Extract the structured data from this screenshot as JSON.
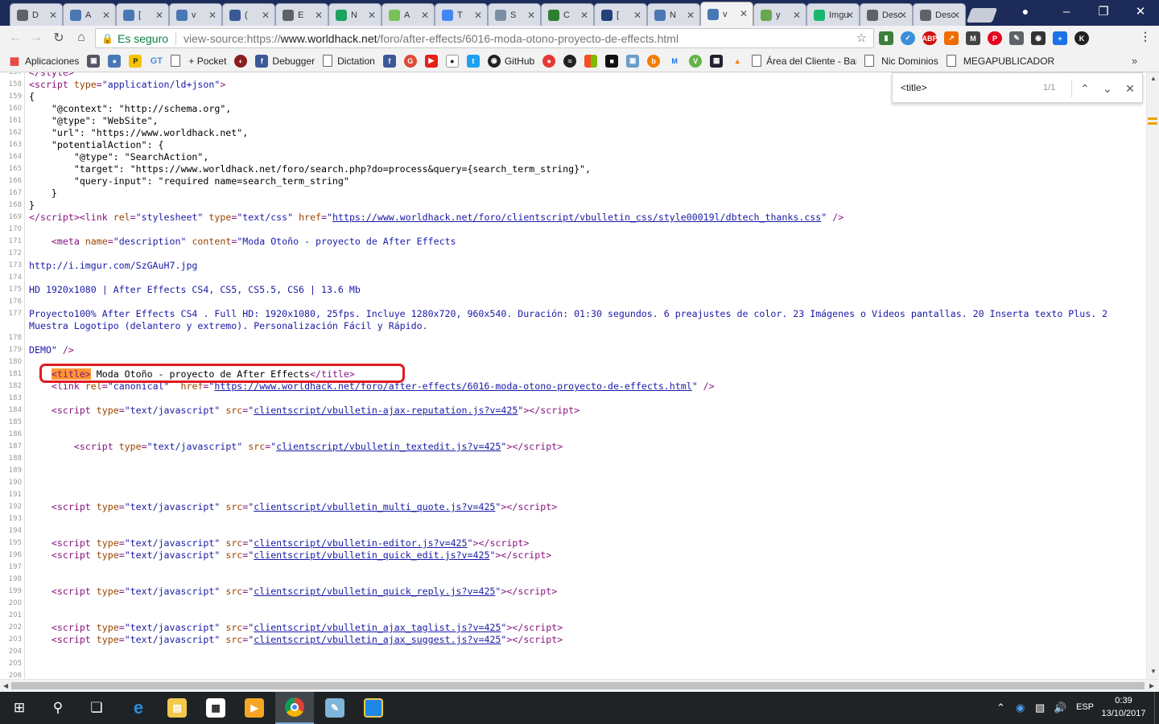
{
  "browser": {
    "tabs": [
      {
        "title": "D",
        "icon": "document-icon",
        "color": "#5f6368"
      },
      {
        "title": "A",
        "icon": "worldhack-icon",
        "color": "#4a78b5"
      },
      {
        "title": "[",
        "icon": "worldhack-icon",
        "color": "#4a78b5"
      },
      {
        "title": "v",
        "icon": "worldhack-icon",
        "color": "#4a78b5"
      },
      {
        "title": "(",
        "icon": "facebook-icon",
        "color": "#3b5998"
      },
      {
        "title": "E",
        "icon": "document-icon",
        "color": "#5f6368"
      },
      {
        "title": "N",
        "icon": "play-icon",
        "color": "#1aa260"
      },
      {
        "title": "A",
        "icon": "android-icon",
        "color": "#78c257"
      },
      {
        "title": "T",
        "icon": "translate-icon",
        "color": "#4285f4"
      },
      {
        "title": "S",
        "icon": "save-icon",
        "color": "#7a8fa6"
      },
      {
        "title": "C",
        "icon": "game-icon",
        "color": "#2e7d32"
      },
      {
        "title": "[",
        "icon": "mastodon-icon",
        "color": "#24427a"
      },
      {
        "title": "N",
        "icon": "worldhack-icon",
        "color": "#4a78b5"
      },
      {
        "title": "v",
        "icon": "worldhack-icon",
        "color": "#4a78b5",
        "active": true
      },
      {
        "title": "y",
        "icon": "circle-green-icon",
        "color": "#6aa84f"
      },
      {
        "title": "Imgu",
        "icon": "imgur-icon",
        "color": "#1bb76e"
      },
      {
        "title": "Desc",
        "icon": "download-icon",
        "color": "#5f6368"
      },
      {
        "title": "Desc",
        "icon": "document-icon",
        "color": "#5f6368"
      }
    ],
    "omnibox": {
      "secure_label": "Es seguro",
      "url_prefix": "view-source:",
      "url_scheme": "https://",
      "url_host": "www.worldhack.net",
      "url_path": "/foro/after-effects/6016-moda-otono-proyecto-de-effects.html"
    }
  },
  "bookmarks": {
    "apps_label": "Aplicaciones",
    "pocket_label": "+ Pocket",
    "debugger_label": "Debugger",
    "dictation_label": "Dictation",
    "github_label": "GitHub",
    "area_cliente_label": "Área del Cliente - Bar",
    "nic_label": "Nic Dominios",
    "megapub_label": "MEGAPUBLICADOR",
    "gt_label": "GT"
  },
  "find": {
    "query": "<title>",
    "count": "1/1"
  },
  "source": {
    "lines": [
      {
        "n": "157",
        "html": "<span class='tag'>&lt;/style&gt;</span>"
      },
      {
        "n": "158",
        "html": "<span class='tag'>&lt;script</span> <span class='attr'>type</span><span class='tag'>=</span><span class='val'>\"application/ld+json\"</span><span class='tag'>&gt;</span>"
      },
      {
        "n": "159",
        "html": "{"
      },
      {
        "n": "160",
        "html": "    \"@context\": \"http://schema.org\","
      },
      {
        "n": "161",
        "html": "    \"@type\": \"WebSite\","
      },
      {
        "n": "162",
        "html": "    \"url\": \"https://www.worldhack.net\","
      },
      {
        "n": "163",
        "html": "    \"potentialAction\": {"
      },
      {
        "n": "164",
        "html": "        \"@type\": \"SearchAction\","
      },
      {
        "n": "165",
        "html": "        \"target\": \"https://www.worldhack.net/foro/search.php?do=process&amp;query={search_term_string}\","
      },
      {
        "n": "166",
        "html": "        \"query-input\": \"required name=search_term_string\""
      },
      {
        "n": "167",
        "html": "    }"
      },
      {
        "n": "168",
        "html": "}"
      },
      {
        "n": "169",
        "html": "<span class='tag'>&lt;/script&gt;&lt;link</span> <span class='attr'>rel</span><span class='tag'>=</span><span class='val'>\"stylesheet\"</span> <span class='attr'>type</span><span class='tag'>=</span><span class='val'>\"text/css\"</span> <span class='attr'>href</span><span class='tag'>=</span><span class='val'>\"<span class='link'>https://www.worldhack.net/foro/clientscript/vbulletin_css/style00019l/dbtech_thanks.css</span>\"</span> <span class='tag'>/&gt;</span>"
      },
      {
        "n": "170",
        "html": ""
      },
      {
        "n": "171",
        "html": "    <span class='tag'>&lt;meta</span> <span class='attr'>name</span><span class='tag'>=</span><span class='val'>\"description\"</span> <span class='attr'>content</span><span class='tag'>=</span><span class='val'>\"Moda Otoño - proyecto de After Effects</span>"
      },
      {
        "n": "172",
        "html": ""
      },
      {
        "n": "173",
        "html": "<span class='val'>http://i.imgur.com/SzGAuH7.jpg</span>"
      },
      {
        "n": "174",
        "html": ""
      },
      {
        "n": "175",
        "html": "<span class='val'>HD 1920x1080 | After Effects CS4, CS5, CS5.5, CS6 | 13.6 Mb</span>"
      },
      {
        "n": "176",
        "html": ""
      },
      {
        "n": "177",
        "html": "<span class='val'>Proyecto100% After Effects CS4 . Full HD: 1920x1080, 25fps. Incluye 1280x720, 960x540. Duración: 01:30 segundos. 6 preajustes de color. 23 Imágenes o Videos pantallas. 20 Inserta texto Plus. 2</span>"
      },
      {
        "n": "",
        "html": "<span class='val'>Muestra Logotipo (delantero y extremo). Personalización Fácil y Rápido.</span>"
      },
      {
        "n": "178",
        "html": ""
      },
      {
        "n": "179",
        "html": "<span class='val'>DEMO\"</span> <span class='tag'>/&gt;</span>"
      },
      {
        "n": "180",
        "html": ""
      },
      {
        "n": "181",
        "html": "    <span class='tag hl'>&lt;title&gt;</span> Moda Otoño - proyecto de After Effects<span class='tag'>&lt;/title&gt;</span>"
      },
      {
        "n": "182",
        "html": "    <span class='tag'>&lt;link</span> <span class='attr'>rel</span><span class='tag'>=</span><span class='val'>\"canonical\"</span>  <span class='attr'>href</span><span class='tag'>=</span><span class='val'>\"<span class='link'>https://www.worldhack.net/foro/after-effects/6016-moda-otono-proyecto-de-effects.html</span>\"</span> <span class='tag'>/&gt;</span>"
      },
      {
        "n": "183",
        "html": ""
      },
      {
        "n": "184",
        "html": "    <span class='tag'>&lt;script</span> <span class='attr'>type</span><span class='tag'>=</span><span class='val'>\"text/javascript\"</span> <span class='attr'>src</span><span class='tag'>=</span><span class='val'>\"<span class='link'>clientscript/vbulletin-ajax-reputation.js?v=425</span>\"</span><span class='tag'>&gt;&lt;/script&gt;</span>"
      },
      {
        "n": "185",
        "html": ""
      },
      {
        "n": "186",
        "html": ""
      },
      {
        "n": "187",
        "html": "        <span class='tag'>&lt;script</span> <span class='attr'>type</span><span class='tag'>=</span><span class='val'>\"text/javascript\"</span> <span class='attr'>src</span><span class='tag'>=</span><span class='val'>\"<span class='link'>clientscript/vbulletin_textedit.js?v=425</span>\"</span><span class='tag'>&gt;&lt;/script&gt;</span>"
      },
      {
        "n": "188",
        "html": ""
      },
      {
        "n": "189",
        "html": ""
      },
      {
        "n": "190",
        "html": ""
      },
      {
        "n": "191",
        "html": ""
      },
      {
        "n": "192",
        "html": "    <span class='tag'>&lt;script</span> <span class='attr'>type</span><span class='tag'>=</span><span class='val'>\"text/javascript\"</span> <span class='attr'>src</span><span class='tag'>=</span><span class='val'>\"<span class='link'>clientscript/vbulletin_multi_quote.js?v=425</span>\"</span><span class='tag'>&gt;&lt;/script&gt;</span>"
      },
      {
        "n": "193",
        "html": ""
      },
      {
        "n": "194",
        "html": ""
      },
      {
        "n": "195",
        "html": "    <span class='tag'>&lt;script</span> <span class='attr'>type</span><span class='tag'>=</span><span class='val'>\"text/javascript\"</span> <span class='attr'>src</span><span class='tag'>=</span><span class='val'>\"<span class='link'>clientscript/vbulletin-editor.js?v=425</span>\"</span><span class='tag'>&gt;&lt;/script&gt;</span>"
      },
      {
        "n": "196",
        "html": "    <span class='tag'>&lt;script</span> <span class='attr'>type</span><span class='tag'>=</span><span class='val'>\"text/javascript\"</span> <span class='attr'>src</span><span class='tag'>=</span><span class='val'>\"<span class='link'>clientscript/vbulletin_quick_edit.js?v=425</span>\"</span><span class='tag'>&gt;&lt;/script&gt;</span>"
      },
      {
        "n": "197",
        "html": ""
      },
      {
        "n": "198",
        "html": ""
      },
      {
        "n": "199",
        "html": "    <span class='tag'>&lt;script</span> <span class='attr'>type</span><span class='tag'>=</span><span class='val'>\"text/javascript\"</span> <span class='attr'>src</span><span class='tag'>=</span><span class='val'>\"<span class='link'>clientscript/vbulletin_quick_reply.js?v=425</span>\"</span><span class='tag'>&gt;&lt;/script&gt;</span>"
      },
      {
        "n": "200",
        "html": ""
      },
      {
        "n": "201",
        "html": ""
      },
      {
        "n": "202",
        "html": "    <span class='tag'>&lt;script</span> <span class='attr'>type</span><span class='tag'>=</span><span class='val'>\"text/javascript\"</span> <span class='attr'>src</span><span class='tag'>=</span><span class='val'>\"<span class='link'>clientscript/vbulletin_ajax_taglist.js?v=425</span>\"</span><span class='tag'>&gt;&lt;/script&gt;</span>"
      },
      {
        "n": "203",
        "html": "    <span class='tag'>&lt;script</span> <span class='attr'>type</span><span class='tag'>=</span><span class='val'>\"text/javascript\"</span> <span class='attr'>src</span><span class='tag'>=</span><span class='val'>\"<span class='link'>clientscript/vbulletin_ajax_suggest.js?v=425</span>\"</span><span class='tag'>&gt;&lt;/script&gt;</span>"
      },
      {
        "n": "204",
        "html": ""
      },
      {
        "n": "205",
        "html": ""
      },
      {
        "n": "206",
        "html": ""
      }
    ]
  },
  "taskbar": {
    "time": "0:39",
    "date": "13/10/2017",
    "language": "ESP"
  }
}
